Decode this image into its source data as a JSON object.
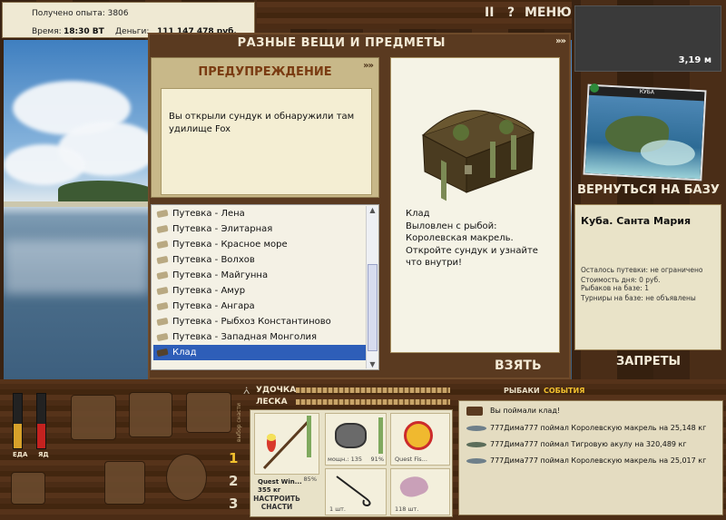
{
  "info": {
    "exp_label": "Получено опыта: 3806",
    "time_label": "Время:",
    "time_value": "18:30 ВТ",
    "money_label": "Деньги:",
    "money_value": "111 147 478 руб."
  },
  "topbar": {
    "pause": "II",
    "help": "?",
    "menu": "МЕНЮ"
  },
  "depth": "3,19 м",
  "items_window": {
    "title": "РАЗНЫЕ ВЕЩИ И ПРЕДМЕТЫ",
    "arrows": "»»",
    "take_button": "ВЗЯТЬ"
  },
  "warning": {
    "title": "ПРЕДУПРЕЖДЕНИЕ",
    "arrows": "»»",
    "message": "Вы открыли сундук и обнаружили там удилище Fox"
  },
  "list": {
    "items": [
      "Путевка - Лена",
      "Путевка - Элитарная",
      "Путевка - Красное море",
      "Путевка - Волхов",
      "Путевка - Майгунна",
      "Путевка - Амур",
      "Путевка - Ангара",
      "Путевка - Рыбхоз Константиново",
      "Путевка - Западная Монголия",
      "Клад"
    ],
    "selected_index": 9
  },
  "detail": {
    "line1": "Клад",
    "line2": "Выловлен с рыбой: Королевская макрель.",
    "line3": "Откройте сундук и узнайте что внутри!"
  },
  "map": {
    "caption": "КУБА"
  },
  "back_button": "ВЕРНУТЬСЯ НА БАЗУ",
  "base": {
    "title": "Куба. Санта Мария",
    "trip_left": "Осталось путевки: не ограничено",
    "day_cost": "Стоимость дня: 0 руб.",
    "anglers": "Рыбаков на базе: 1",
    "tournaments": "Турниры на базе: не объявлены"
  },
  "bans_button": "ЗАПРЕТЫ",
  "gauges": {
    "food_label": "ЕДА",
    "food_level": 0.45,
    "poison_label": "ЯД",
    "poison_level": 0.45,
    "food_color": "#d7a12a",
    "poison_color": "#c4221f"
  },
  "tackle": {
    "rod_label": "УДОЧКА",
    "line_label": "ЛЕСКА",
    "rod_name": "Quest Win...",
    "rod_weight": "355 кг",
    "rod_pct": "85%",
    "reel_label": "мощн.: 135",
    "reel_pct": "91%",
    "line_name": "Quest Fis...",
    "hook_count": "1 шт.",
    "bait_count": "118 шт.",
    "setup_button": "НАСТРОИТЬ СНАСТИ",
    "set_numbers": [
      "1",
      "2",
      "3"
    ],
    "vertical_label": "выбор снасти"
  },
  "events": {
    "tab_anglers": "РЫБАКИ",
    "tab_events": "СОБЫТИЯ",
    "rows": [
      {
        "text": "Вы поймали клад!",
        "icon": "chest-icon"
      },
      {
        "text": "777Дима777 поймал Королевскую макрель на 25,148 кг",
        "icon": "fish-icon"
      },
      {
        "text": "777Дима777 поймал Тигровую акулу на 320,489 кг",
        "icon": "fish-icon"
      },
      {
        "text": "777Дима777 поймал Королевскую макрель на 25,017 кг",
        "icon": "fish-icon"
      }
    ]
  },
  "colors": {
    "accent_title": "#7a3b12",
    "selection": "#2e5eb8",
    "light_text": "#f3ead6"
  }
}
